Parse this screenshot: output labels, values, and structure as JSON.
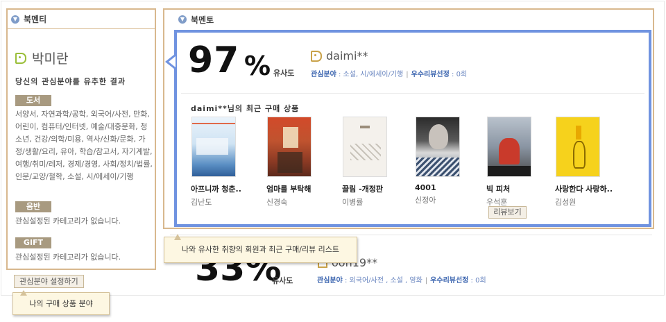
{
  "left_panel": {
    "header": "북멘티",
    "mentor_name": "박미란",
    "analysis_title": "당신의 관심분야를 유추한 결과",
    "categories": [
      {
        "label": "도서",
        "text": "서양서, 자연과학/공학, 외국어/사전, 만화, 어린이, 컴퓨터/인터넷, 예술/대중문화, 청소년, 건강/의학/미용, 역사/신화/문화, 가정/생활/요리, 유아, 학습/참고서, 자기계발, 여행/취미/레저, 경제/경영, 사회/정치/법률, 인문/교양/철학, 소설, 시/에세이/기행"
      },
      {
        "label": "음반",
        "text": "관심설정된 카테고리가 없습니다."
      },
      {
        "label": "GIFT",
        "text": "관심설정된 카테고리가 없습니다."
      }
    ],
    "interest_button": "관심분야 설정하기",
    "tooltip": "나의 구매 상품 분야"
  },
  "right_panel": {
    "header": "북멘토",
    "tooltip": "나와 유사한 취향의 회원과 최근 구매/리뷰 리스트",
    "top_match": {
      "similarity": "97",
      "percent_sign": "%",
      "similarity_label": "유사도",
      "user": "daimi**",
      "interest_label": "관심분야",
      "interest_value": "소설, 시/에세이/기행",
      "review_label": "우수리뷰선정",
      "review_value": "0회",
      "recent_title": "daimi**님의 최근 구매 상품",
      "books": [
        {
          "title": "아프니까 청춘..",
          "author": "김난도"
        },
        {
          "title": "엄마를 부탁해",
          "author": "신경숙"
        },
        {
          "title": "끌림 -개정판",
          "author": "이병률"
        },
        {
          "title": "4001",
          "author": "신정아"
        },
        {
          "title": "빅 피처",
          "author": "우석훈"
        },
        {
          "title": "사랑한다 사랑하..",
          "author": "김성원"
        }
      ],
      "review_button": "리뷰보기"
    },
    "next_match": {
      "similarity": "33%",
      "similarity_label": "유사도",
      "user": "oon19**",
      "interest_label": "관심분야",
      "interest_value": "외국어/사전 , 소설 , 영화",
      "review_label": "우수리뷰선정",
      "review_value": "0회"
    }
  },
  "colors": {
    "panel_border": "#d8b88e",
    "card_border": "#7093e0",
    "badge": "#a89a80",
    "link_blue": "#3d66b0",
    "tooltip_bg": "#fdf7e2"
  }
}
